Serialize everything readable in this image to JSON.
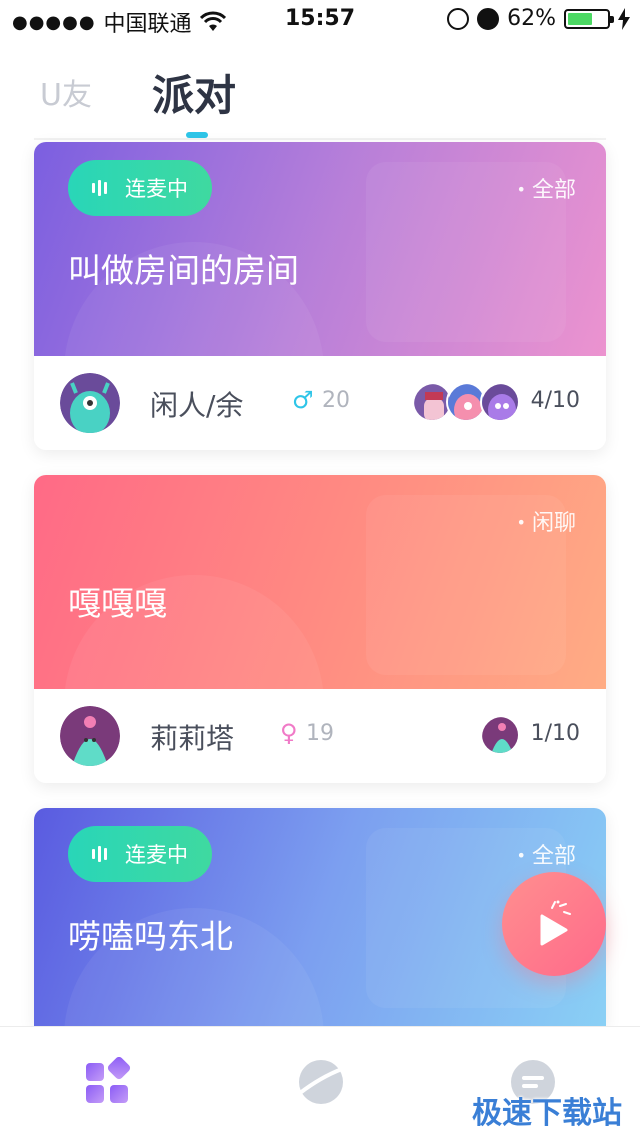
{
  "status_bar": {
    "signal_dots": "●●●●●",
    "carrier": "中国联通",
    "time": "15:57",
    "battery_percent": "62%",
    "battery_level": 0.62,
    "icons": [
      "wifi-icon",
      "orientation-lock-icon",
      "alarm-icon",
      "battery-icon",
      "charging-icon"
    ]
  },
  "top_tabs": [
    {
      "label": "U友",
      "active": false
    },
    {
      "label": "派对",
      "active": true
    }
  ],
  "rooms": [
    {
      "live_label": "连麦中",
      "live": true,
      "tag": "全部",
      "title": "叫做房间的房间",
      "host_name": "闲人/余",
      "gender_symbol": "♂",
      "gender_color": "#2ec5e8",
      "age": "20",
      "count": "4/10",
      "gradient": [
        "#7b5fe0",
        "#b77fd9",
        "#ec93cf"
      ]
    },
    {
      "live_label": "",
      "live": false,
      "tag": "闲聊",
      "title": "嘎嘎嘎",
      "host_name": "莉莉塔",
      "gender_symbol": "♀",
      "gender_color": "#f07ac7",
      "age": "19",
      "count": "1/10",
      "gradient": [
        "#ff6a86",
        "#ff8a82",
        "#ffac84"
      ]
    },
    {
      "live_label": "连麦中",
      "live": true,
      "tag": "全部",
      "title": "唠嗑吗东北",
      "gradient": [
        "#5a5be0",
        "#7c9ff0",
        "#8ad0f5"
      ]
    }
  ],
  "fab": {
    "icon": "party-popper-icon"
  },
  "bottom_tabs": [
    {
      "icon": "grid-icon",
      "active": true
    },
    {
      "icon": "planet-icon",
      "active": false
    },
    {
      "icon": "chat-icon",
      "active": false
    }
  ],
  "watermark": "极速下载站"
}
